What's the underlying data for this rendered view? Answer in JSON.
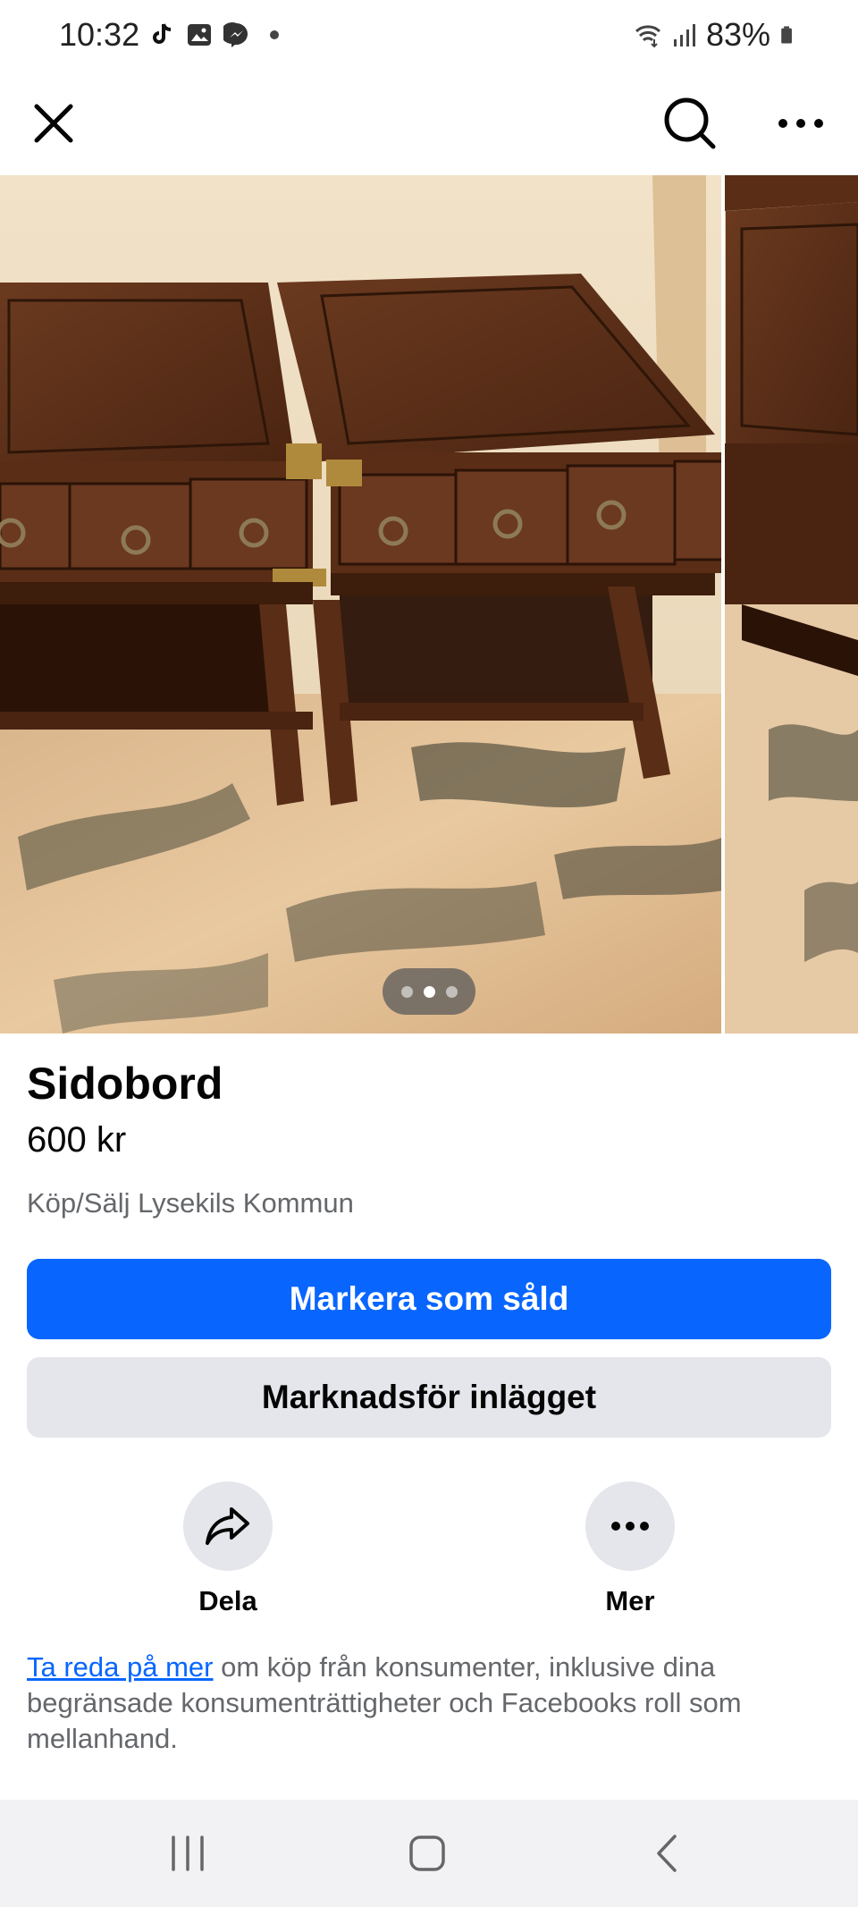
{
  "status_bar": {
    "time": "10:32",
    "battery": "83%",
    "left_icons": [
      "tiktok-icon",
      "gallery-icon",
      "messenger-icon",
      "dot-icon"
    ],
    "right_icons": [
      "wifi-icon",
      "signal-icon",
      "battery-icon"
    ]
  },
  "top_bar": {
    "icons": [
      "close-icon",
      "search-icon",
      "more-icon"
    ]
  },
  "carousel": {
    "photo_count": 3,
    "active_index": 1
  },
  "listing": {
    "title": "Sidobord",
    "price": "600 kr",
    "group": "Köp/Sälj Lysekils Kommun"
  },
  "buttons": {
    "mark_sold": "Markera som såld",
    "promote": "Marknadsför inlägget"
  },
  "actions": {
    "share_label": "Dela",
    "more_label": "Mer"
  },
  "info": {
    "link_text": "Ta reda på mer",
    "rest_text": " om köp från konsumenter, inklusive dina begränsade konsumenträttigheter och Facebooks roll som mellanhand."
  },
  "colors": {
    "primary": "#0866ff",
    "secondary_bg": "#e4e6eb",
    "muted_text": "#65676b"
  }
}
